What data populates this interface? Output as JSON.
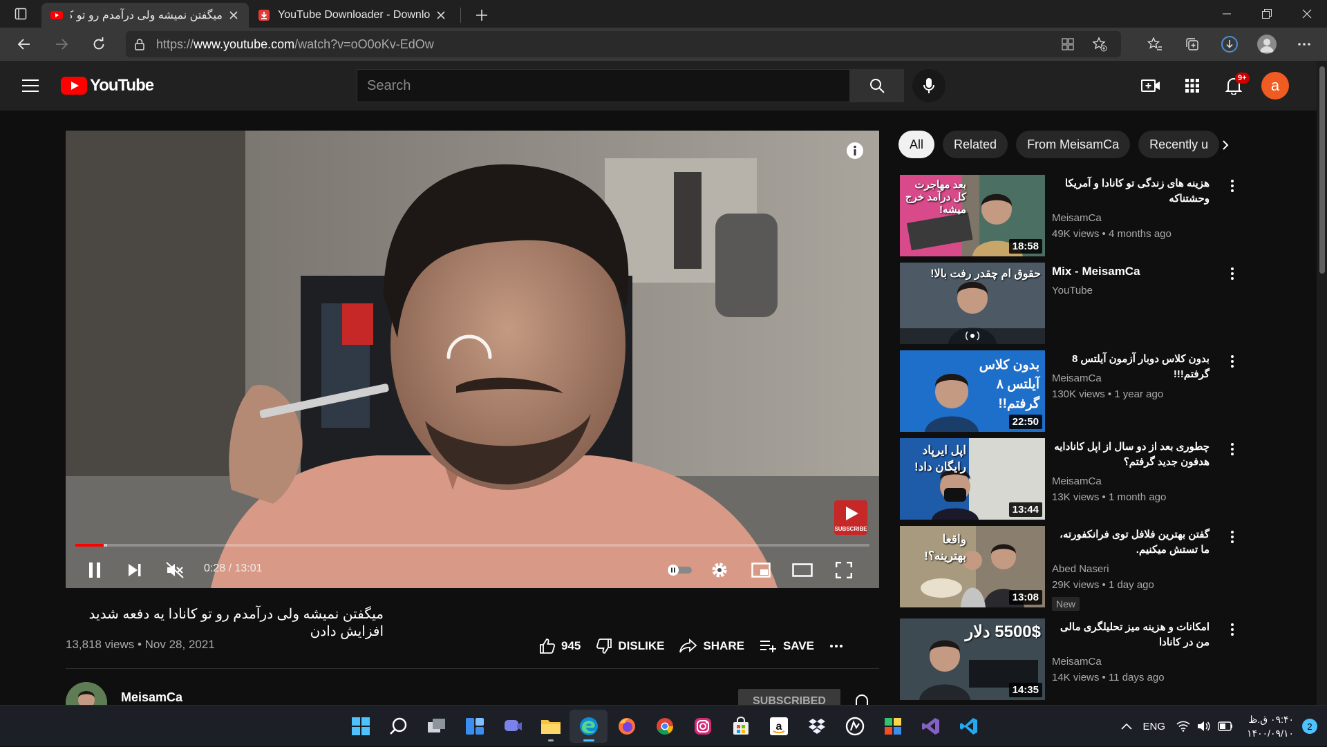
{
  "browser": {
    "tabs": [
      {
        "title": "میگفتن نمیشه ولی درآمدم رو تو کانادا",
        "active": true
      },
      {
        "title": "YouTube Downloader - Download",
        "active": false
      }
    ],
    "url_prefix": "https://",
    "url_domain": "www.youtube.com",
    "url_path": "/watch?v=oO0oKv-EdOw"
  },
  "youtube": {
    "logo_text": "YouTube",
    "search_placeholder": "Search",
    "notification_count": "9+",
    "account_initial": "a"
  },
  "player": {
    "time_display": "0:28 / 13:01",
    "progress_fraction": 0.036,
    "subscribe_watermark": "SUBSCRIBE"
  },
  "video": {
    "title": "میگفتن نمیشه ولی درآمدم رو تو کانادا یه دفعه شدید افزایش دادن",
    "views": "13,818 views",
    "date": "Nov 28, 2021",
    "likes": "945",
    "dislike_label": "DISLIKE",
    "share_label": "SHARE",
    "save_label": "SAVE",
    "channel": "MeisamCa",
    "subscribed_label": "SUBSCRIBED"
  },
  "chips": [
    "All",
    "Related",
    "From MeisamCa",
    "Recently u"
  ],
  "recommendations": [
    {
      "title": "هزینه های زندگی تو کانادا و آمریکا وحشتناکه",
      "channel": "MeisamCa",
      "meta": "49K views • 4 months ago",
      "duration": "18:58",
      "thumb_text": "بعد مهاجرت کل درآمد خرج میشه!",
      "rtl": true
    },
    {
      "title": "Mix - MeisamCa",
      "channel": "YouTube",
      "meta": "",
      "duration": "",
      "thumb_text": "حقوق ام چقدر رفت بالا!",
      "rtl": false
    },
    {
      "title": "بدون کلاس دوبار آزمون آیلتس 8 گرفتم!!!",
      "channel": "MeisamCa",
      "meta": "130K views • 1 year ago",
      "duration": "22:50",
      "thumb_text": "بدون کلاس آیلتس ۸ گرفتم!!",
      "rtl": true
    },
    {
      "title": "چطوری بعد از دو سال از اپل کانادایه هدفون جدید گرفتم؟",
      "channel": "MeisamCa",
      "meta": "13K views • 1 month ago",
      "duration": "13:44",
      "thumb_text": "اپل ایرپاد رایگان داد!",
      "rtl": true
    },
    {
      "title": "گفتن بهترین فلافل توی فرانکفورته، ما تستش میکنیم.",
      "channel": "Abed Naseri",
      "meta": "29K views • 1 day ago",
      "duration": "13:08",
      "thumb_text": "واقعا بهترینه؟!",
      "rtl": true,
      "badge": "New"
    },
    {
      "title": "امکانات و هزینه میز تحلیلگری مالی من در کانادا",
      "channel": "MeisamCa",
      "meta": "14K views • 11 days ago",
      "duration": "14:35",
      "thumb_text": "5500$ دلار",
      "rtl": true
    }
  ],
  "taskbar": {
    "language": "ENG",
    "time": "۰۹:۴۰ ق.ظ",
    "date": "۱۴۰۰/۰۹/۱۰",
    "notifications": "2"
  }
}
